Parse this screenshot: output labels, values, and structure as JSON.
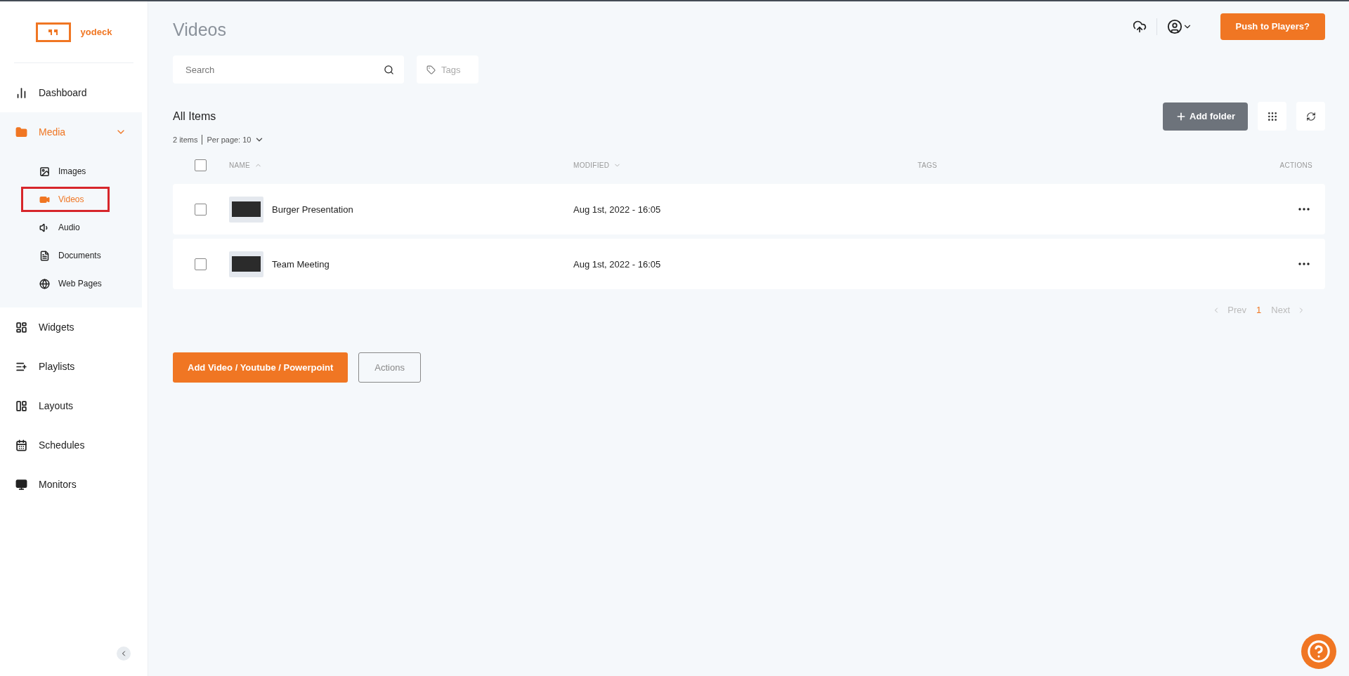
{
  "logo": {
    "text": "yodeck"
  },
  "sidebar": {
    "items": [
      {
        "label": "Dashboard",
        "selected": false
      },
      {
        "label": "Media",
        "selected": true,
        "expanded": true,
        "children": [
          {
            "label": "Images",
            "selected": false,
            "outlined": false
          },
          {
            "label": "Videos",
            "selected": true,
            "outlined": true
          },
          {
            "label": "Audio",
            "selected": false,
            "outlined": false
          },
          {
            "label": "Documents",
            "selected": false,
            "outlined": false
          },
          {
            "label": "Web Pages",
            "selected": false,
            "outlined": false
          }
        ]
      },
      {
        "label": "Widgets",
        "selected": false
      },
      {
        "label": "Playlists",
        "selected": false
      },
      {
        "label": "Layouts",
        "selected": false
      },
      {
        "label": "Schedules",
        "selected": false
      },
      {
        "label": "Monitors",
        "selected": false
      }
    ]
  },
  "header": {
    "title": "Videos",
    "push_button": "Push to Players?"
  },
  "search": {
    "placeholder": "Search"
  },
  "tags_filter": {
    "placeholder": "Tags"
  },
  "section": {
    "title": "All Items",
    "count": "2 items",
    "per_page_label": "Per page:",
    "per_page_value": "10",
    "add_folder": "Add folder"
  },
  "table": {
    "select_all_checked": false,
    "columns": [
      {
        "label": "NAME",
        "sorted_ascending": true,
        "sorted_descending": false
      },
      {
        "label": "MODIFIED",
        "sorted_ascending": false,
        "sorted_descending": true
      },
      {
        "label": "TAGS",
        "sorted_ascending": false,
        "sorted_descending": false
      },
      {
        "label": "ACTIONS",
        "sorted_ascending": false,
        "sorted_descending": false
      }
    ],
    "rows": [
      {
        "name": "Burger Presentation",
        "modified": "Aug 1st, 2022 - 16:05",
        "checked": false
      },
      {
        "name": "Team Meeting",
        "modified": "Aug 1st, 2022 - 16:05",
        "checked": false
      }
    ]
  },
  "pagination": {
    "prev": "Prev",
    "next": "Next",
    "prev_disabled": true,
    "next_disabled": true,
    "pages": [
      {
        "label": "1",
        "selected": true
      }
    ]
  },
  "footer_buttons": {
    "primary": "Add Video / Youtube / Powerpoint",
    "secondary": "Actions"
  }
}
